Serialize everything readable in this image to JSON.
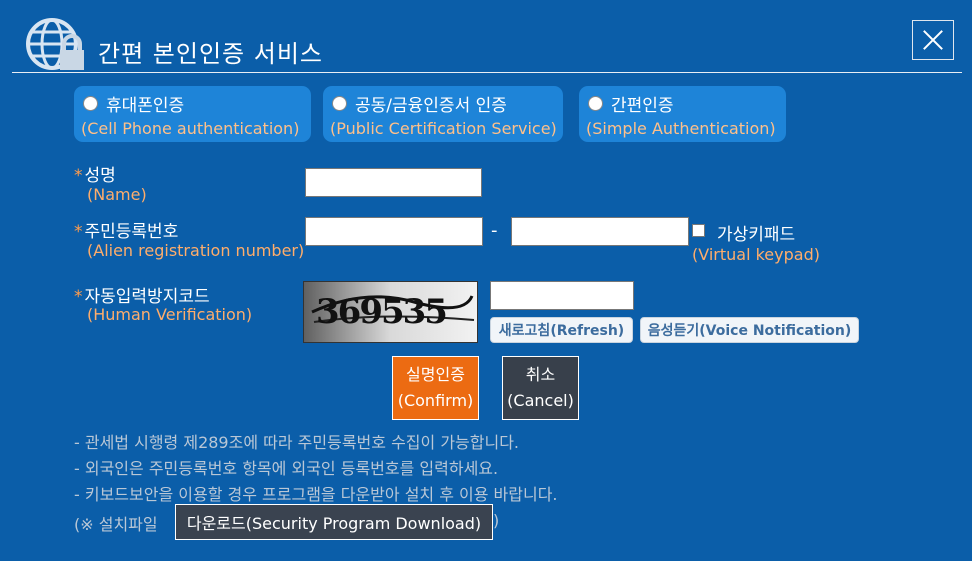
{
  "header": {
    "title": "간편 본인인증 서비스",
    "logo_icon": "globe-lock-icon",
    "close_icon": "close-icon"
  },
  "tabs": [
    {
      "label": "휴대폰인증",
      "sub": "(Cell Phone authentication)"
    },
    {
      "label": "공동/금융인증서 인증",
      "sub": "(Public Certification Service)"
    },
    {
      "label": "간편인증",
      "sub": "(Simple Authentication)"
    }
  ],
  "fields": {
    "name": {
      "asterisk": "*",
      "label": "성명",
      "sub": "(Name)",
      "value": ""
    },
    "alien": {
      "asterisk": "*",
      "label": "주민등록번호",
      "sub": "(Alien registration number)",
      "first": "",
      "second": "",
      "dash": "-"
    },
    "virtual_keypad": {
      "label": "가상키패드",
      "sub": "(Virtual keypad)"
    },
    "captcha": {
      "asterisk": "*",
      "label": "자동입력방지코드",
      "sub": "(Human Verification)",
      "image_text": "369535",
      "value": ""
    }
  },
  "buttons": {
    "refresh": "새로고침(Refresh)",
    "voice": "음성듣기(Voice Notification)",
    "confirm_line1": "실명인증",
    "confirm_line2": "(Confirm)",
    "cancel_line1": "취소",
    "cancel_line2": "(Cancel)",
    "download": "다운로드(Security Program Download)"
  },
  "notes": {
    "line1": "- 관세법 시행령 제289조에 따라 주민등록번호 수집이 가능합니다.",
    "line2": "- 외국인은 주민등록번호 항목에 외국인 등록번호를 입력하세요.",
    "line3": "- 키보드보안을 이용할 경우 프로그램을 다운받아 설치 후 이용 바랍니다.",
    "prefix": "(※ 설치파일",
    "suffix": ")"
  },
  "colors": {
    "background": "#0b5ea9",
    "tab": "#1e84d8",
    "accent": "#ec6b12",
    "sub_text": "#ffad6b"
  }
}
